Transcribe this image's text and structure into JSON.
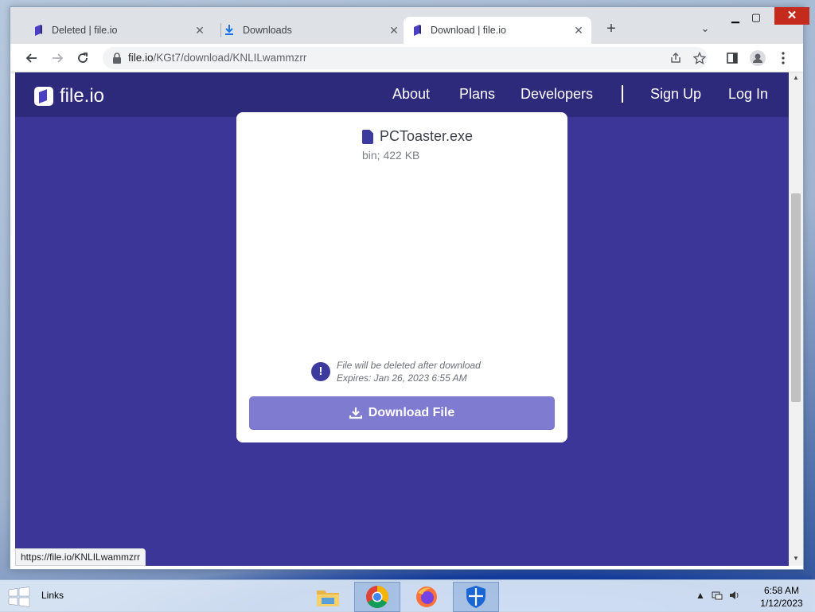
{
  "browser": {
    "tabs": [
      {
        "label": "Deleted | file.io",
        "icon": "fileio-favicon",
        "active": false
      },
      {
        "label": "Downloads",
        "icon": "download-favicon",
        "active": false
      },
      {
        "label": "Download | file.io",
        "icon": "fileio-favicon",
        "active": true
      }
    ],
    "url_host": "file.io",
    "url_path": "/KGt7/download/KNLILwammzrr",
    "status_url": "https://file.io/KNLILwammzrr"
  },
  "site": {
    "logo_text": "file.io",
    "nav": {
      "about": "About",
      "plans": "Plans",
      "developers": "Developers",
      "sign_up": "Sign Up",
      "log_in": "Log In"
    },
    "colors": {
      "background": "#3b3698",
      "navbar": "#2d2a7c",
      "button": "#7f7bd0",
      "accent": "#3d3a9e"
    }
  },
  "download_card": {
    "file_name": "PCToaster.exe",
    "file_meta": "bin; 422 KB",
    "notice_line1": "File will be deleted after download",
    "notice_line2": "Expires: Jan 26, 2023 6:55 AM",
    "button_label": "Download File"
  },
  "taskbar": {
    "links_label": "Links",
    "apps": [
      "file-explorer",
      "chrome",
      "firefox",
      "windows-defender"
    ],
    "time": "6:58 AM",
    "date": "1/12/2023"
  }
}
